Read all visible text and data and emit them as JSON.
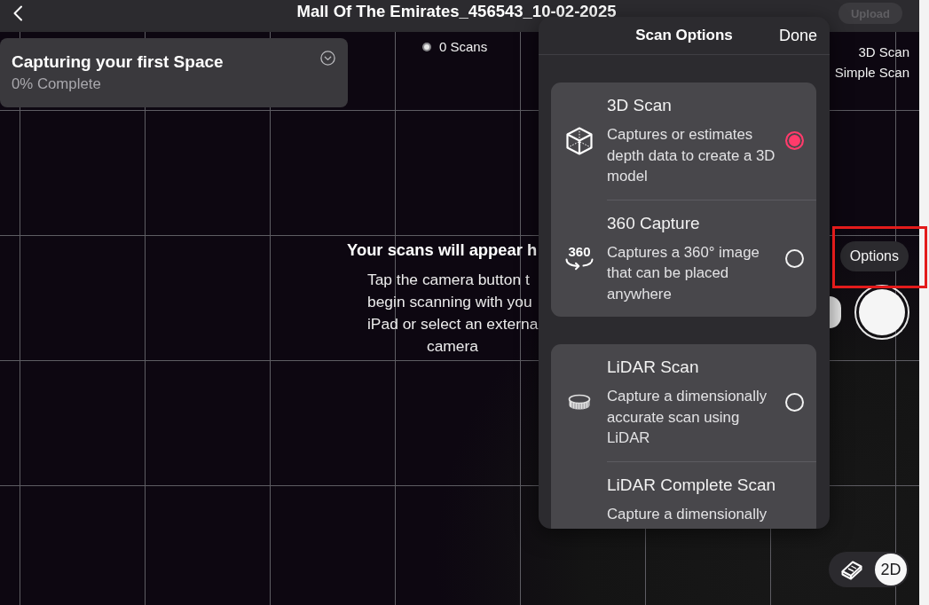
{
  "top_bar": {
    "title": "Mall Of The Emirates_456543_10-02-2025",
    "upload_button": {
      "label": "Upload",
      "disabled": true
    }
  },
  "progress_card": {
    "title": "Capturing your first Space",
    "subtitle": "0% Complete"
  },
  "scan_count": "0 Scans",
  "scan_modes": [
    "3D Scan",
    "Simple Scan"
  ],
  "empty_state": {
    "heading": "Your scans will appear h",
    "lines": [
      "Tap the camera button t",
      "begin scanning with you",
      "iPad or select an externa",
      "camera"
    ]
  },
  "scan_options": {
    "title": "Scan Options",
    "done": "Done",
    "groups": [
      {
        "items": [
          {
            "title": "3D Scan",
            "description": "Captures or estimates depth data to create a 3D model",
            "selected": true
          },
          {
            "title": "360 Capture",
            "icon_text": "360",
            "description": "Captures a 360° image that can be placed anywhere",
            "selected": false
          }
        ]
      },
      {
        "items": [
          {
            "title": "LiDAR Scan",
            "description": "Capture a dimensionally accurate scan using LiDAR",
            "selected": false
          },
          {
            "title": "LiDAR Complete Scan",
            "description": "Capture a dimensionally"
          }
        ]
      }
    ]
  },
  "options_button": {
    "label": "Options",
    "highlighted": true
  },
  "view_toggle": [
    {
      "kind": "icon",
      "selected": false
    },
    {
      "kind": "text",
      "label": "2D",
      "selected": true
    }
  ]
}
